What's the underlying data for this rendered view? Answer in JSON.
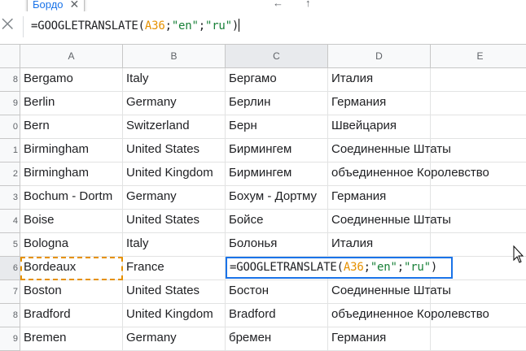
{
  "tooltip": {
    "text": "Бордо",
    "close": "✕"
  },
  "top_icons": [
    "←",
    "↑"
  ],
  "formula_bar": {
    "fx_glyph": "⨉",
    "prefix": "=GOOGLETRANSLATE(",
    "ref": "A36",
    "sep1": ";",
    "arg2": "\"en\"",
    "sep2": ";",
    "arg3": "\"ru\"",
    "suffix": ")"
  },
  "columns": [
    "A",
    "B",
    "C",
    "D",
    "E"
  ],
  "active_column": "C",
  "rows": [
    {
      "num": "8",
      "a": "Bergamo",
      "b": "Italy",
      "c": "Бергамо",
      "d": "Италия"
    },
    {
      "num": "9",
      "a": "Berlin",
      "b": "Germany",
      "c": "Берлин",
      "d": "Германия"
    },
    {
      "num": "0",
      "a": "Bern",
      "b": "Switzerland",
      "c": "Берн",
      "d": "Швейцария"
    },
    {
      "num": "1",
      "a": "Birmingham",
      "b": "United States",
      "c": "Бирмингем",
      "d": "Соединенные Штаты"
    },
    {
      "num": "2",
      "a": "Birmingham",
      "b": "United Kingdom",
      "c": "Бирмингем",
      "d": "объединенное Королевство"
    },
    {
      "num": "3",
      "a": "Bochum - Dortm",
      "b": "Germany",
      "c": "Бохум - Дортму",
      "d": "Германия"
    },
    {
      "num": "4",
      "a": "Boise",
      "b": "United States",
      "c": "Бойсе",
      "d": "Соединенные Штаты"
    },
    {
      "num": "5",
      "a": "Bologna",
      "b": "Italy",
      "c": "Болонья",
      "d": "Италия"
    },
    {
      "num": "6",
      "a": "Bordeaux",
      "b": "France",
      "c": "",
      "d": ""
    },
    {
      "num": "7",
      "a": "Boston",
      "b": "United States",
      "c": "Бостон",
      "d": "Соединенные Штаты"
    },
    {
      "num": "8",
      "a": "Bradford",
      "b": "United Kingdom",
      "c": "Bradford",
      "d": "объединенное Королевство"
    },
    {
      "num": "9",
      "a": "Bremen",
      "b": "Germany",
      "c": "бремен",
      "d": "Германия"
    }
  ],
  "editor": {
    "prefix": "=GOOGLETRANSLATE(",
    "ref": "A36",
    "sep1": ";",
    "arg2": "\"en\"",
    "sep2": ";",
    "arg3": "\"ru\"",
    "suffix": ")"
  },
  "colors": {
    "accent": "#1a73e8",
    "ref": "#e69100",
    "string": "#188038"
  }
}
